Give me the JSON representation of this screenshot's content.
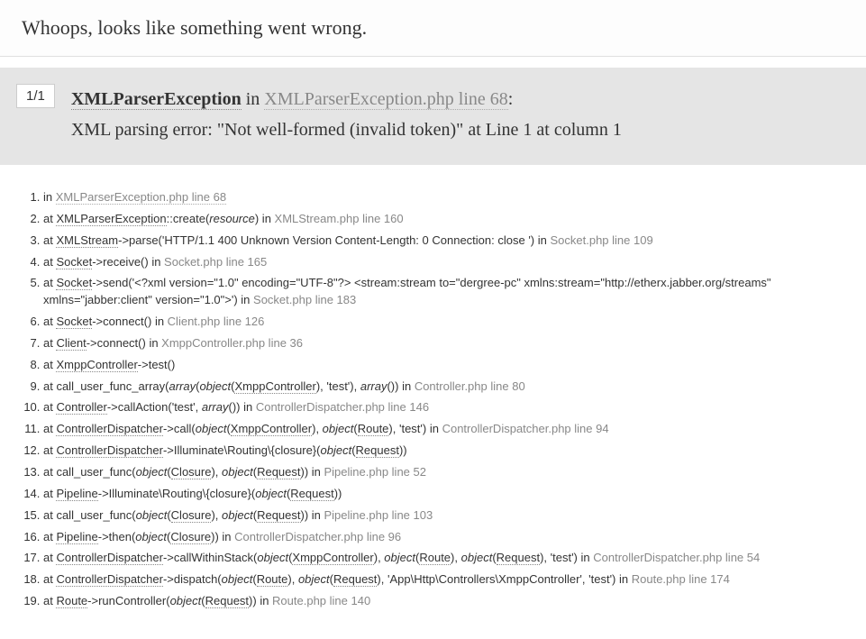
{
  "header": {
    "title": "Whoops, looks like something went wrong."
  },
  "exception": {
    "count": "1/1",
    "name": "XMLParserException",
    "in": "in",
    "file": "XMLParserException.php line 68",
    "colon": ":",
    "message": "XML parsing error: \"Not well-formed (invalid token)\" at Line 1 at column 1"
  },
  "trace": [
    {
      "raw": "in <um>XMLParserException.php line 68</um>"
    },
    {
      "raw": "at <u>XMLParserException</u>::create(<i>resource</i>) in <m>XMLStream.php line 160</m>"
    },
    {
      "raw": "at <u>XMLStream</u>->parse('HTTP/1.1 400 Unknown Version Content-Length: 0 Connection: close ') in <m>Socket.php line 109</m>"
    },
    {
      "raw": "at <u>Socket</u>->receive() in <m>Socket.php line 165</m>"
    },
    {
      "raw": "at <u>Socket</u>->send('&lt;?xml version=\"1.0\" encoding=\"UTF-8\"?&gt; &lt;stream:stream to=\"dergree-pc\" xmlns:stream=\"http://etherx.jabber.org/streams\" xmlns=\"jabber:client\" version=\"1.0\"&gt;') in <m>Socket.php line 183</m>"
    },
    {
      "raw": "at <u>Socket</u>->connect() in <m>Client.php line 126</m>"
    },
    {
      "raw": "at <u>Client</u>->connect() in <m>XmppController.php line 36</m>"
    },
    {
      "raw": "at <u>XmppController</u>->test()"
    },
    {
      "raw": "at call_user_func_array(<i>array</i>(<i>object</i>(<u>XmppController</u>), 'test'), <i>array</i>()) in <m>Controller.php line 80</m>"
    },
    {
      "raw": "at <u>Controller</u>->callAction('test', <i>array</i>()) in <m>ControllerDispatcher.php line 146</m>"
    },
    {
      "raw": "at <u>ControllerDispatcher</u>->call(<i>object</i>(<u>XmppController</u>), <i>object</i>(<u>Route</u>), 'test') in <m>ControllerDispatcher.php line 94</m>"
    },
    {
      "raw": "at <u>ControllerDispatcher</u>->Illuminate\\Routing\\{closure}(<i>object</i>(<u>Request</u>))"
    },
    {
      "raw": "at call_user_func(<i>object</i>(<u>Closure</u>), <i>object</i>(<u>Request</u>)) in <m>Pipeline.php line 52</m>"
    },
    {
      "raw": "at <u>Pipeline</u>->Illuminate\\Routing\\{closure}(<i>object</i>(<u>Request</u>))"
    },
    {
      "raw": "at call_user_func(<i>object</i>(<u>Closure</u>), <i>object</i>(<u>Request</u>)) in <m>Pipeline.php line 103</m>"
    },
    {
      "raw": "at <u>Pipeline</u>->then(<i>object</i>(<u>Closure</u>)) in <m>ControllerDispatcher.php line 96</m>"
    },
    {
      "raw": "at <u>ControllerDispatcher</u>->callWithinStack(<i>object</i>(<u>XmppController</u>), <i>object</i>(<u>Route</u>), <i>object</i>(<u>Request</u>), 'test') in <m>ControllerDispatcher.php line 54</m>"
    },
    {
      "raw": "at <u>ControllerDispatcher</u>->dispatch(<i>object</i>(<u>Route</u>), <i>object</i>(<u>Request</u>), 'App\\Http\\Controllers\\XmppController', 'test') in <m>Route.php line 174</m>"
    },
    {
      "raw": "at <u>Route</u>->runController(<i>object</i>(<u>Request</u>)) in <m>Route.php line 140</m>"
    }
  ]
}
